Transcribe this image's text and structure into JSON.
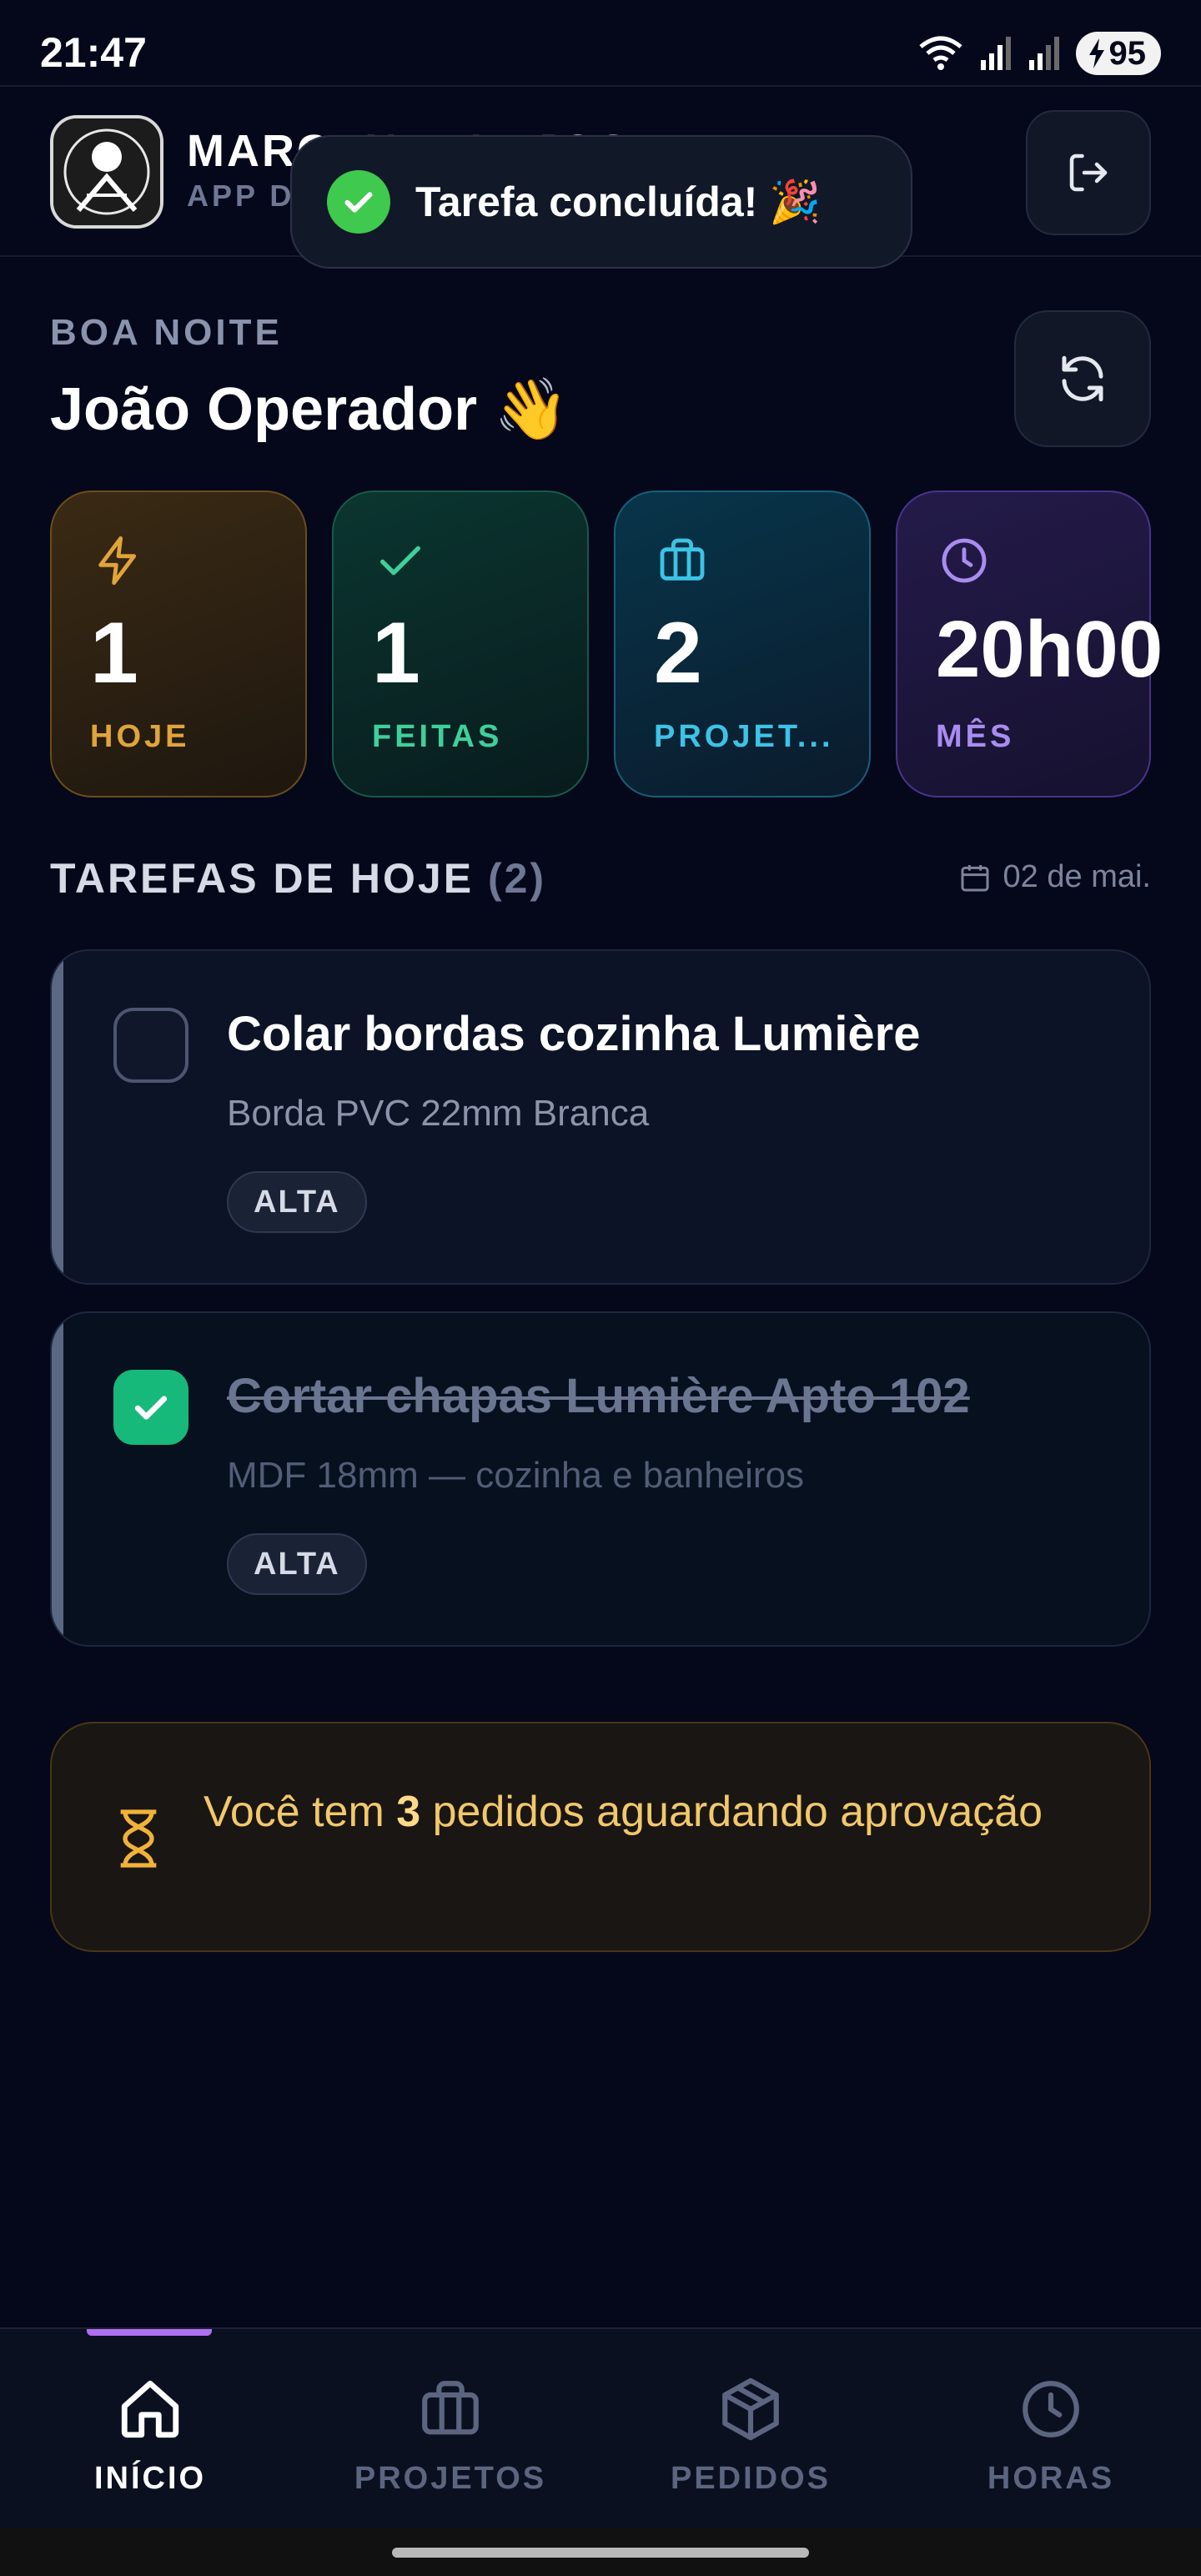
{
  "status_bar": {
    "time": "21:47",
    "battery": "95"
  },
  "header": {
    "company_name": "MARCENARIA JOSE",
    "company_subtitle": "APP D",
    "logout_label": "Sair"
  },
  "toast": {
    "text": "Tarefa concluída! 🎉"
  },
  "greeting": {
    "label": "BOA NOITE",
    "name": "João Operador 👋"
  },
  "stats": [
    {
      "value": "1",
      "label": "HOJE",
      "icon": "lightning-icon",
      "color": "#e0a43a"
    },
    {
      "value": "1",
      "label": "FEITAS",
      "icon": "check-icon",
      "color": "#3fcf9a"
    },
    {
      "value": "2",
      "label": "PROJET...",
      "icon": "briefcase-icon",
      "color": "#3cc3e6"
    },
    {
      "value": "20h00",
      "label": "MÊS",
      "icon": "clock-icon",
      "color": "#a98cf0"
    }
  ],
  "section": {
    "title": "TAREFAS DE HOJE",
    "count": "(2)",
    "date": "02 de mai."
  },
  "tasks": [
    {
      "title": "Colar bordas cozinha Lumière",
      "subtitle": "Borda PVC 22mm Branca",
      "priority": "ALTA",
      "done": false
    },
    {
      "title": "Cortar chapas Lumière Apto 102",
      "subtitle": "MDF 18mm — cozinha e banheiros",
      "priority": "ALTA",
      "done": true
    }
  ],
  "banner": {
    "prefix": "Você tem ",
    "count": "3",
    "suffix": " pedidos aguardando aprovação"
  },
  "nav": [
    {
      "label": "INÍCIO",
      "icon": "home-icon",
      "active": true
    },
    {
      "label": "PROJETOS",
      "icon": "briefcase-icon",
      "active": false
    },
    {
      "label": "PEDIDOS",
      "icon": "box-icon",
      "active": false
    },
    {
      "label": "HORAS",
      "icon": "clock-icon",
      "active": false
    }
  ],
  "colors": {
    "background": "#05081a",
    "accent": "#b06ef2",
    "success": "#17b97a"
  }
}
